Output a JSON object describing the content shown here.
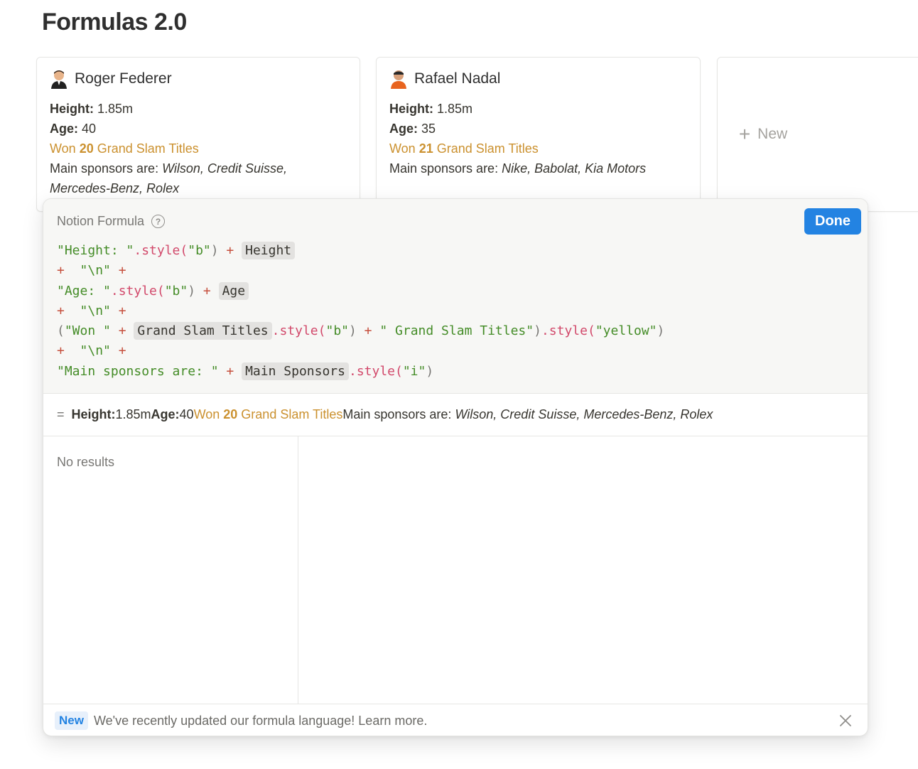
{
  "page": {
    "title": "Formulas 2.0"
  },
  "cards": [
    {
      "name": "Roger Federer",
      "height_label": "Height:",
      "height_value": "1.85m",
      "age_label": "Age:",
      "age_value": "40",
      "won_prefix": "Won ",
      "won_count": "20",
      "won_suffix": " Grand Slam Titles",
      "sponsors_label": "Main sponsors are: ",
      "sponsors": "Wilson, Credit Suisse,",
      "sponsors_2": "Mercedes-Benz, Rolex"
    },
    {
      "name": "Rafael Nadal",
      "height_label": "Height:",
      "height_value": "1.85m",
      "age_label": "Age:",
      "age_value": "35",
      "won_prefix": "Won ",
      "won_count": "21",
      "won_suffix": " Grand Slam Titles",
      "sponsors_label": "Main sponsors are: ",
      "sponsors": "Nike, Babolat, Kia Motors"
    }
  ],
  "new_card": {
    "label": "New"
  },
  "formula": {
    "title": "Notion Formula",
    "done_label": "Done",
    "code": {
      "l1_str": "\"Height: \"",
      "style_fn": ".style(",
      "b_arg": "\"b\"",
      "close": ")",
      "plus": " + ",
      "height_prop": "Height",
      "nl_plus": "+  ",
      "nl_str": "\"\\n\"",
      "nl_tail": " +",
      "l3_str": "\"Age: \"",
      "age_prop": "Age",
      "l5_open": "(",
      "l5_str": "\"Won \"",
      "gst_prop": "Grand Slam Titles",
      "l5_str2": "\" Grand Slam Titles\"",
      "yellow_arg": "\"yellow\"",
      "l7_str": "\"Main sponsors are: \"",
      "ms_prop": "Main Sponsors",
      "i_arg": "\"i\""
    },
    "result": {
      "eq": "=",
      "height_label": "Height:",
      "height_value": " 1.85m ",
      "age_label": "Age:",
      "age_value": " 40 ",
      "won_prefix": "Won ",
      "won_count": "20",
      "won_suffix": " Grand Slam Titles",
      "sponsors_label": " Main sponsors are: ",
      "sponsors": "Wilson, Credit Suisse, Mercedes-Benz, Rolex"
    },
    "no_results": "No results",
    "footer": {
      "badge": "New",
      "message": "We've recently updated our formula language! Learn more."
    }
  },
  "colors": {
    "accent": "#2383e2",
    "yellow": "#cb912f",
    "string": "#448c27",
    "method": "#d2496b"
  }
}
